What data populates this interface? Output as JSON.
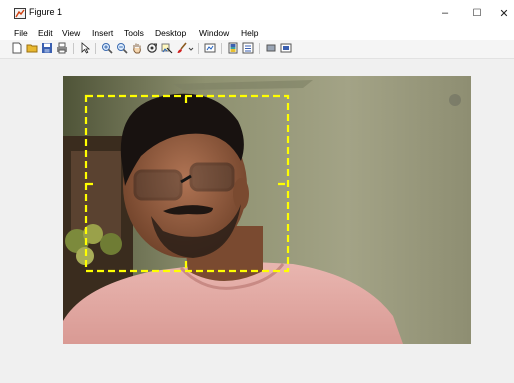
{
  "window": {
    "title": "Figure 1",
    "minimize_symbol": "–",
    "maximize_symbol": "☐",
    "close_symbol": "✕"
  },
  "menu": {
    "items": [
      "File",
      "Edit",
      "View",
      "Insert",
      "Tools",
      "Desktop",
      "Window",
      "Help"
    ]
  },
  "toolbar": {
    "icons": [
      "new-figure-icon",
      "open-file-icon",
      "save-icon",
      "print-icon",
      "edit-plot-arrow-icon",
      "zoom-in-icon",
      "zoom-out-icon",
      "pan-hand-icon",
      "rotate-3d-icon",
      "data-cursor-icon",
      "brush-icon",
      "link-plot-icon",
      "insert-colorbar-icon",
      "insert-legend-icon",
      "hide-plot-tools-icon",
      "show-plot-tools-icon"
    ]
  },
  "figure": {
    "image_content": "webcam frame of a person with a face-detection bounding box",
    "bbox_color": "#ffff00",
    "bbox_style": "dashed"
  },
  "colors": {
    "titlebar_bg": "#ffffff",
    "toolbar_bg": "#f5f5f5",
    "figure_bg": "#f0f0f0"
  }
}
